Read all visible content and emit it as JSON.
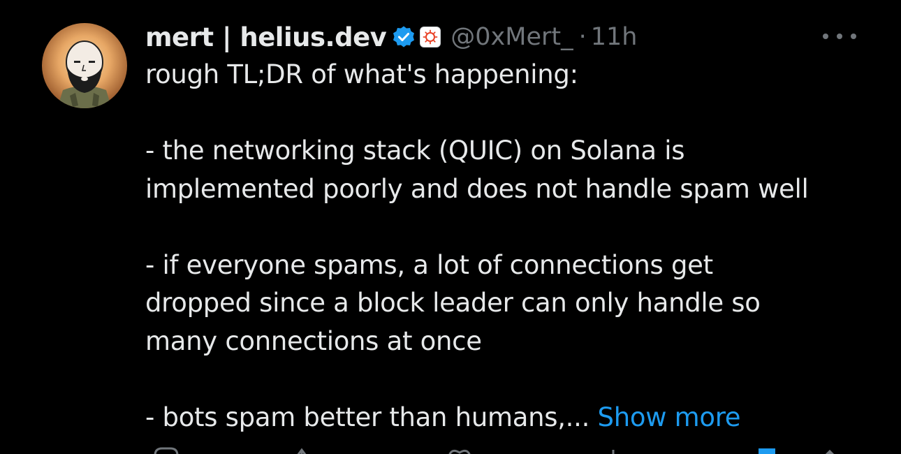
{
  "author": {
    "display_name": "mert | helius.dev",
    "handle": "@0xMert_",
    "separator": "·",
    "time": "11h"
  },
  "icons": {
    "verified": "verified-badge-icon",
    "affiliate": "affiliate-badge-icon",
    "more": "more-options-icon"
  },
  "colors": {
    "background": "#000000",
    "text": "#e7e9ea",
    "muted": "#71767b",
    "accent": "#1d9bf0"
  },
  "body": {
    "intro": "rough TL;DR of what's happening:",
    "p1_l1": "- the networking stack (QUIC) on Solana is",
    "p1_l2": "implemented poorly and does not handle spam well",
    "p2_l1": "- if everyone spams, a lot of connections get",
    "p2_l2": "dropped since a block leader can only handle so",
    "p2_l3": "many connections at once",
    "p3_l1": "- bots spam better than humans,...",
    "show_more": "Show more"
  }
}
